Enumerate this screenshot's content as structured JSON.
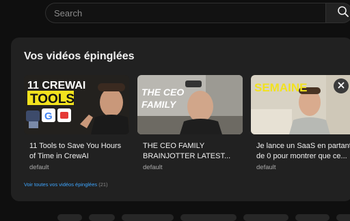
{
  "search": {
    "placeholder": "Search"
  },
  "pinned": {
    "title": "Vos vidéos épinglées",
    "see_all_label": "Voir toutes vos vidéos épinglées",
    "see_all_count": "(21)",
    "videos": [
      {
        "title": "11 Tools to Save You Hours of Time in CrewAI",
        "subtitle": "default",
        "thumb_text_line1": "11 CREWAI",
        "thumb_text_line2": "TOOLS"
      },
      {
        "title": "THE CEO FAMILY BRAINJOTTER LATEST...",
        "subtitle": "default",
        "thumb_text_line1": "THE CEO",
        "thumb_text_line2": "FAMILY"
      },
      {
        "title": "Je lance un SaaS en partant de 0 pour montrer que ce...",
        "subtitle": "default",
        "thumb_text_line1": "SEMAINE"
      }
    ]
  },
  "icons": {
    "search": "search-icon",
    "close": "close-icon"
  },
  "colors": {
    "background": "#0f0f0f",
    "panel": "#212121",
    "link": "#3ea6ff",
    "thumb1_title_bg": "#f2e21e"
  }
}
